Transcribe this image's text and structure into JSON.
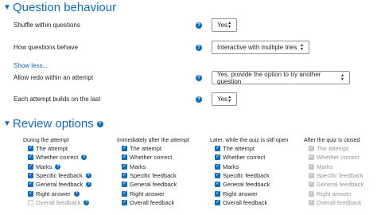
{
  "question_behaviour": {
    "title": "Question behaviour",
    "shuffle": {
      "label": "Shuffle within questions",
      "value": "Yes"
    },
    "how_behave": {
      "label": "How questions behave",
      "value": "Interactive with multiple tries"
    },
    "show_less": "Show less...",
    "redo": {
      "label": "Allow redo within an attempt",
      "value": "Yes, provide the option to try another question"
    },
    "builds": {
      "label": "Each attempt builds on the last",
      "value": "Yes"
    }
  },
  "review_options": {
    "title": "Review options",
    "columns": [
      {
        "heading": "During the attempt",
        "items": [
          {
            "label": "The attempt",
            "state": "checked"
          },
          {
            "label": "Whether correct",
            "state": "checked",
            "help": true
          },
          {
            "label": "Marks",
            "state": "checked",
            "help": true
          },
          {
            "label": "Specific feedback",
            "state": "checked",
            "help": true
          },
          {
            "label": "General feedback",
            "state": "checked",
            "help": true
          },
          {
            "label": "Right answer",
            "state": "checked",
            "help": true
          },
          {
            "label": "Overall feedback",
            "state": "disabled-unchecked",
            "help": true
          }
        ]
      },
      {
        "heading": "Immediately after the attempt",
        "items": [
          {
            "label": "The attempt",
            "state": "checked"
          },
          {
            "label": "Whether correct",
            "state": "checked"
          },
          {
            "label": "Marks",
            "state": "checked"
          },
          {
            "label": "Specific feedback",
            "state": "checked"
          },
          {
            "label": "General feedback",
            "state": "checked"
          },
          {
            "label": "Right answer",
            "state": "checked"
          },
          {
            "label": "Overall feedback",
            "state": "checked"
          }
        ]
      },
      {
        "heading": "Later, while the quiz is still open",
        "items": [
          {
            "label": "The attempt",
            "state": "checked"
          },
          {
            "label": "Whether correct",
            "state": "checked"
          },
          {
            "label": "Marks",
            "state": "checked"
          },
          {
            "label": "Specific feedback",
            "state": "checked"
          },
          {
            "label": "General feedback",
            "state": "checked"
          },
          {
            "label": "Right answer",
            "state": "checked"
          },
          {
            "label": "Overall feedback",
            "state": "checked"
          }
        ]
      },
      {
        "heading": "After the quiz is closed",
        "items": [
          {
            "label": "The attempt",
            "state": "disabled-checked"
          },
          {
            "label": "Whether correct",
            "state": "disabled-checked"
          },
          {
            "label": "Marks",
            "state": "disabled-checked"
          },
          {
            "label": "Specific feedback",
            "state": "disabled-checked"
          },
          {
            "label": "General feedback",
            "state": "disabled-checked"
          },
          {
            "label": "Right answer",
            "state": "disabled-checked"
          },
          {
            "label": "Overall feedback",
            "state": "disabled-checked"
          }
        ]
      }
    ]
  },
  "icons": {
    "collapse": "chevron-down-icon",
    "help": "question-circle-icon",
    "select": "sort-caret-icon"
  }
}
